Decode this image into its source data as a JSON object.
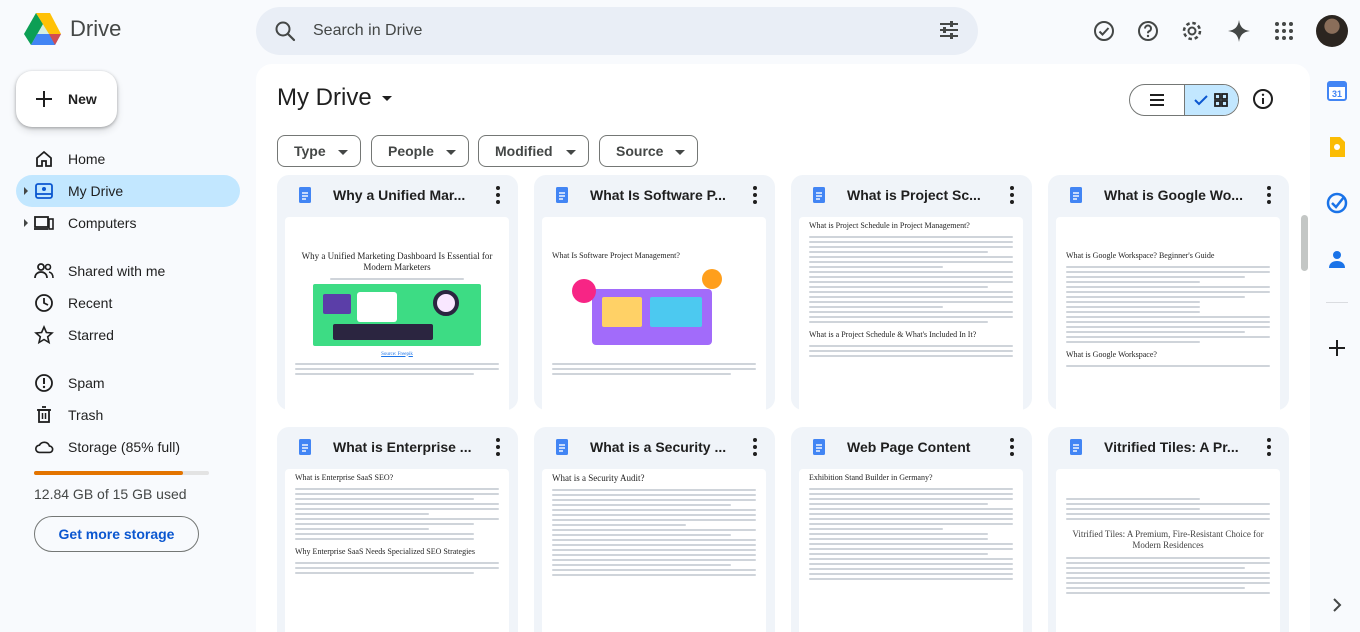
{
  "app": {
    "name": "Drive"
  },
  "search": {
    "placeholder": "Search in Drive"
  },
  "sidebar": {
    "new_label": "New",
    "items": [
      {
        "label": "Home",
        "icon": "home-icon"
      },
      {
        "label": "My Drive",
        "icon": "my-drive-icon",
        "active": true
      },
      {
        "label": "Computers",
        "icon": "computers-icon"
      },
      {
        "label": "Shared with me",
        "icon": "shared-icon"
      },
      {
        "label": "Recent",
        "icon": "recent-icon"
      },
      {
        "label": "Starred",
        "icon": "star-icon"
      },
      {
        "label": "Spam",
        "icon": "spam-icon"
      },
      {
        "label": "Trash",
        "icon": "trash-icon"
      },
      {
        "label": "Storage (85% full)",
        "icon": "cloud-icon"
      }
    ],
    "storage": {
      "percent": 85,
      "text": "12.84 GB of 15 GB used",
      "button": "Get more storage"
    }
  },
  "main": {
    "title": "My Drive",
    "filters": [
      "Type",
      "People",
      "Modified",
      "Source"
    ],
    "files": [
      {
        "title": "Why a Unified Mar...",
        "thumb_heading": "Why a Unified Marketing Dashboard Is Essential for Modern Marketers",
        "thumb_caption": "Source: Freepik"
      },
      {
        "title": "What Is Software P...",
        "thumb_heading": "What Is Software Project Management?"
      },
      {
        "title": "What is Project Sc...",
        "thumb_heading": "What is Project Schedule in Project Management?",
        "thumb_sub": "What is a Project Schedule & What's Included In It?"
      },
      {
        "title": "What is Google Wo...",
        "thumb_heading": "What is Google Workspace? Beginner's Guide",
        "thumb_sub": "What is Google Workspace?"
      },
      {
        "title": "What is Enterprise ...",
        "thumb_heading": "What is Enterprise SaaS SEO?",
        "thumb_sub": "Why Enterprise SaaS Needs Specialized SEO Strategies"
      },
      {
        "title": "What is a Security ...",
        "thumb_heading": "What is a Security Audit?"
      },
      {
        "title": "Web Page Content",
        "thumb_heading": "Exhibition Stand Builder in Germany?"
      },
      {
        "title": "Vitrified Tiles: A Pr...",
        "thumb_heading": "Vitrified Tiles: A Premium, Fire-Resistant Choice for Modern Residences"
      }
    ]
  },
  "colors": {
    "accent": "#0b57d0",
    "active_nav": "#c2e7ff",
    "storage_fill": "#e37400",
    "doc_blue": "#4285f4"
  }
}
